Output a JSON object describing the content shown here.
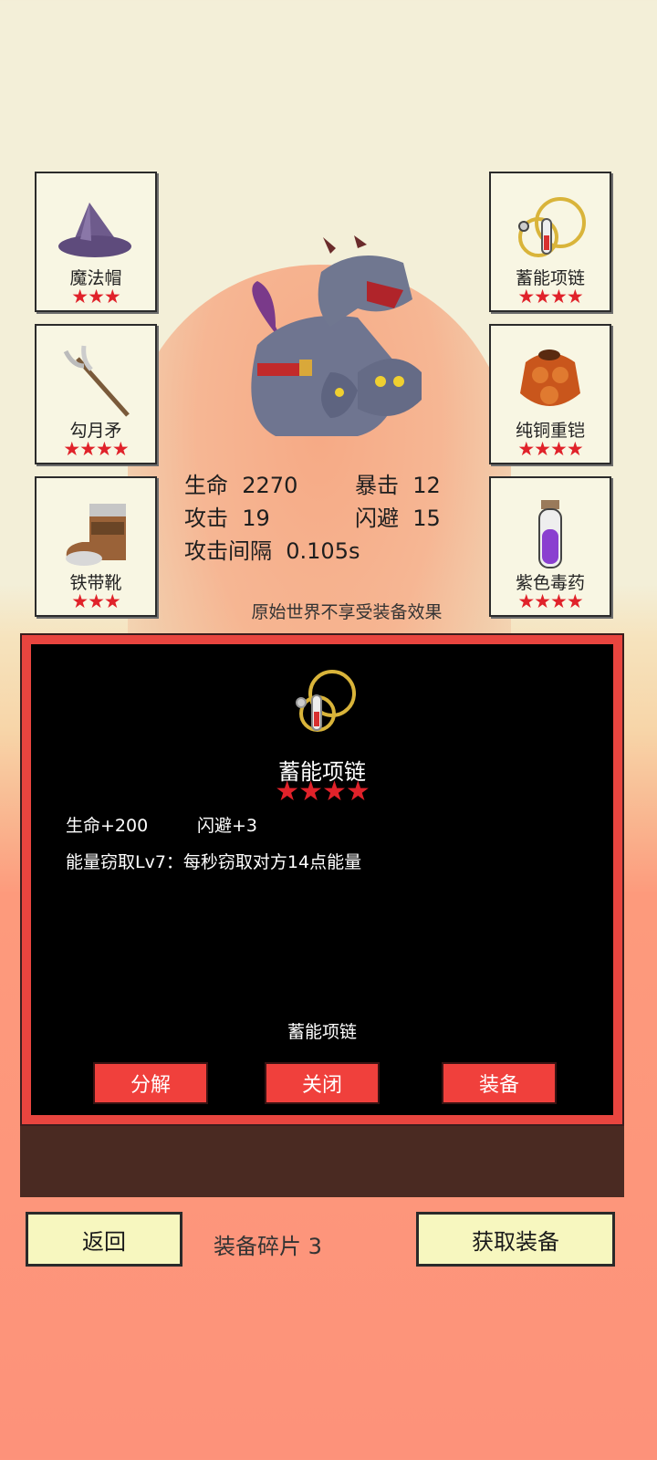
{
  "equipment_slots": {
    "left": [
      {
        "name": "魔法帽",
        "stars": "★★★"
      },
      {
        "name": "勾月矛",
        "stars": "★★★★"
      },
      {
        "name": "铁带靴",
        "stars": "★★★"
      }
    ],
    "right": [
      {
        "name": "蓄能项链",
        "stars": "★★★★"
      },
      {
        "name": "纯铜重铠",
        "stars": "★★★★"
      },
      {
        "name": "紫色毒药",
        "stars": "★★★★"
      }
    ]
  },
  "stats": {
    "hp_label": "生命",
    "hp_value": "2270",
    "crit_label": "暴击",
    "crit_value": "12",
    "atk_label": "攻击",
    "atk_value": "19",
    "dodge_label": "闪避",
    "dodge_value": "15",
    "interval_label": "攻击间隔",
    "interval_value": "0.105s"
  },
  "note": "原始世界不享受装备效果",
  "detail": {
    "name": "蓄能项链",
    "stars": "★★★★",
    "attr1": "生命+200",
    "attr2": "闪避+3",
    "skill": "能量窃取Lv7：每秒窃取对方14点能量",
    "footer_name": "蓄能项链",
    "buttons": {
      "decompose": "分解",
      "close": "关闭",
      "equip": "装备"
    }
  },
  "bottom": {
    "back": "返回",
    "fragments": "装备碎片 3",
    "get_equipment": "获取装备"
  },
  "colors": {
    "star": "#e0222a",
    "panel_border": "#e8453f",
    "button": "#f0403c",
    "bottom_button": "#f7f7bf"
  }
}
